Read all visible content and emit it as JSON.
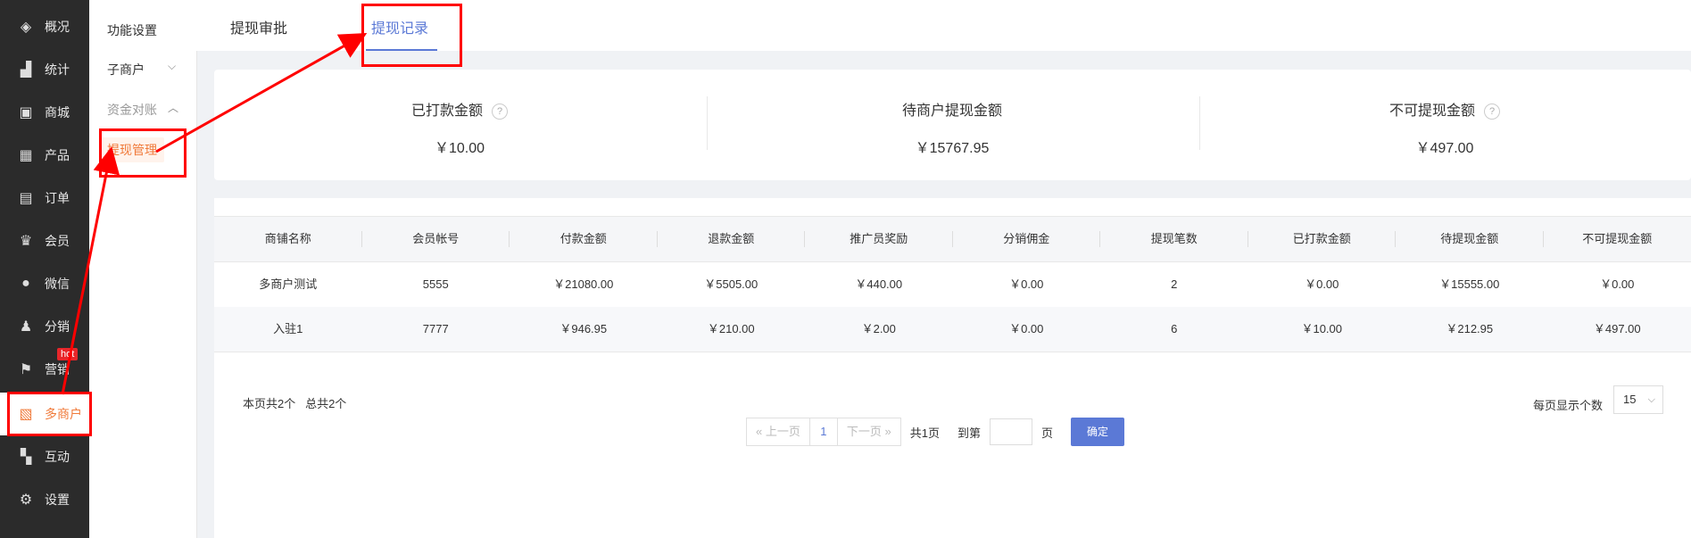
{
  "nav": {
    "items": [
      {
        "label": "概况",
        "icon": "layers-icon",
        "glyph": "◈"
      },
      {
        "label": "统计",
        "icon": "chart-icon",
        "glyph": "▟"
      },
      {
        "label": "商城",
        "icon": "store-icon",
        "glyph": "▣"
      },
      {
        "label": "产品",
        "icon": "grid-icon",
        "glyph": "▦"
      },
      {
        "label": "订单",
        "icon": "clipboard-icon",
        "glyph": "▤"
      },
      {
        "label": "会员",
        "icon": "crown-icon",
        "glyph": "♛"
      },
      {
        "label": "微信",
        "icon": "chat-icon",
        "glyph": "●"
      },
      {
        "label": "分销",
        "icon": "users-icon",
        "glyph": "♟"
      },
      {
        "label": "营销",
        "icon": "flag-icon",
        "glyph": "⚑"
      },
      {
        "label": "多商户",
        "icon": "shop-icon",
        "glyph": "▧"
      },
      {
        "label": "互动",
        "icon": "interact-icon",
        "glyph": "▚"
      },
      {
        "label": "设置",
        "icon": "gear-icon",
        "glyph": "⚙"
      }
    ],
    "hot_badge": "hot"
  },
  "subnav": {
    "function_settings": "功能设置",
    "sub_merchants": "子商户",
    "fund_reconciliation": "资金对账",
    "withdraw_management": "提现管理"
  },
  "tabs": {
    "approval": "提现审批",
    "records": "提现记录"
  },
  "summary": {
    "paid_title": "已打款金额",
    "paid_value": "￥10.00",
    "pending_title": "待商户提现金额",
    "pending_value": "￥15767.95",
    "locked_title": "不可提现金额",
    "locked_value": "￥497.00",
    "help_glyph": "?"
  },
  "table": {
    "headers": [
      "商铺名称",
      "会员帐号",
      "付款金额",
      "退款金额",
      "推广员奖励",
      "分销佣金",
      "提现笔数",
      "已打款金额",
      "待提现金额",
      "不可提现金额"
    ],
    "rows": [
      [
        "多商户测试",
        "5555",
        "￥21080.00",
        "￥5505.00",
        "￥440.00",
        "￥0.00",
        "2",
        "￥0.00",
        "￥15555.00",
        "￥0.00"
      ],
      [
        "入驻1",
        "7777",
        "￥946.95",
        "￥210.00",
        "￥2.00",
        "￥0.00",
        "6",
        "￥10.00",
        "￥212.95",
        "￥497.00"
      ]
    ]
  },
  "footer": {
    "page_count": "本页共2个",
    "total_count": "总共2个",
    "prev": "上一页",
    "current_page": "1",
    "next": "下一页",
    "total_pages": "共1页",
    "goto": "到第",
    "page_unit": "页",
    "confirm": "确定",
    "per_page_label": "每页显示个数",
    "per_page_value": "15"
  }
}
